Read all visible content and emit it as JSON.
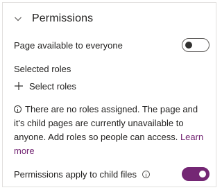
{
  "section": {
    "title": "Permissions",
    "icon": "chevron-down-icon"
  },
  "everyone": {
    "label": "Page available to everyone",
    "toggle_on": false
  },
  "roles": {
    "label": "Selected roles",
    "select_label": "Select roles",
    "select_icon": "plus-icon"
  },
  "info": {
    "icon": "info-icon",
    "message": "There are no roles assigned. The page and it's child pages are currently unavailable to anyone. Add roles so people can access.",
    "link_label": "Learn more"
  },
  "child": {
    "label": "Permissions apply to child files",
    "icon": "info-icon",
    "toggle_on": true
  },
  "colors": {
    "accent": "#742774",
    "text": "#201f1e",
    "border": "#e1dfdd"
  }
}
